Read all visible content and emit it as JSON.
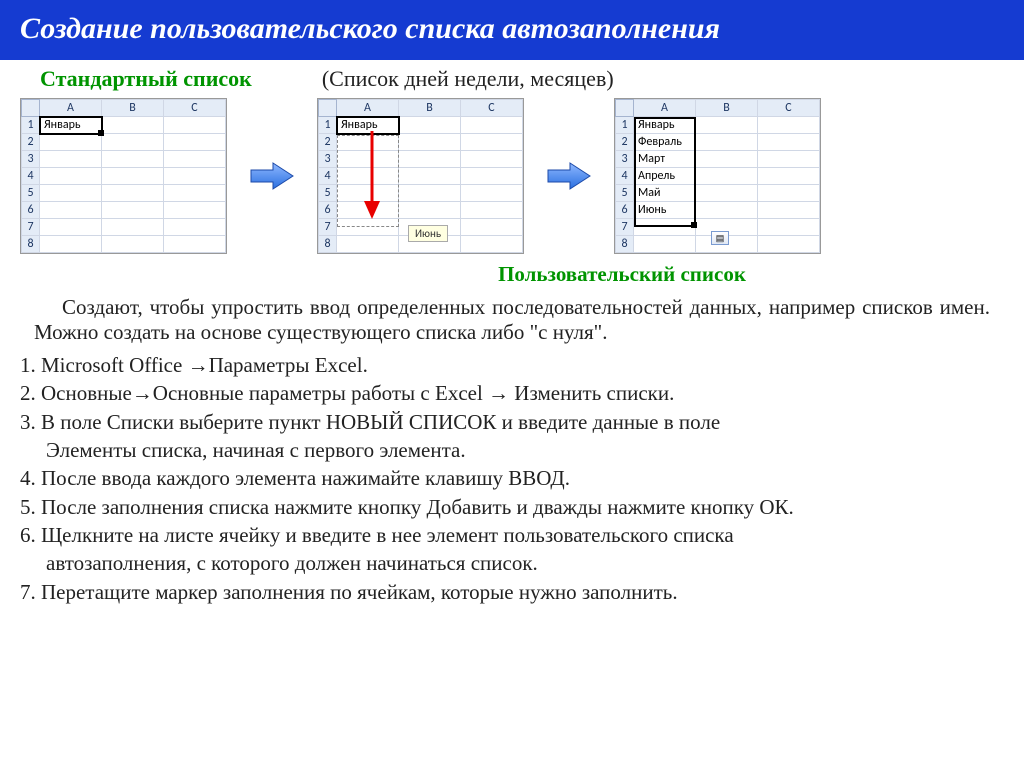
{
  "title": "Создание пользовательского списка автозаполнения",
  "standard_list_label": "Стандартный список",
  "standard_list_desc": "(Список дней недели, месяцев)",
  "user_list_label": "Пользовательский  список",
  "sheet1": {
    "cols": [
      "A",
      "B",
      "C"
    ],
    "rows": [
      "1",
      "2",
      "3",
      "4",
      "5",
      "6",
      "7",
      "8"
    ],
    "A1": "Январь"
  },
  "sheet2": {
    "cols": [
      "A",
      "B",
      "C"
    ],
    "rows": [
      "1",
      "2",
      "3",
      "4",
      "5",
      "6",
      "7",
      "8"
    ],
    "A1": "Январь",
    "tooltip": "Июнь"
  },
  "sheet3": {
    "cols": [
      "A",
      "B",
      "C"
    ],
    "rows": [
      "1",
      "2",
      "3",
      "4",
      "5",
      "6",
      "7",
      "8"
    ],
    "A": [
      "Январь",
      "Февраль",
      "Март",
      "Апрель",
      "Май",
      "Июнь"
    ]
  },
  "paragraph": "Создают, чтобы упростить ввод определенных последовательностей данных, например списков имен.  Можно создать на основе существующего списка либо \"с нуля\".",
  "steps": {
    "s1": "1. Microsoft Office →Параметры Excel.",
    "s2": "2. Основные→Основные параметры работы с Excel → Изменить списки.",
    "s3a": "3. В поле Списки выберите пункт НОВЫЙ СПИСОК и введите данные в поле",
    "s3b": "Элементы списка, начиная с первого элемента.",
    "s4": "4. После ввода каждого элемента нажимайте клавишу ВВОД.",
    "s5": "5. После заполнения списка нажмите кнопку Добавить и дважды нажмите кнопку ОК.",
    "s6a": "6. Щелкните на листе ячейку и введите в нее элемент пользовательского списка",
    "s6b": "автозаполнения, с которого должен начинаться список.",
    "s7": "7. Перетащите маркер заполнения по ячейкам, которые нужно заполнить."
  }
}
